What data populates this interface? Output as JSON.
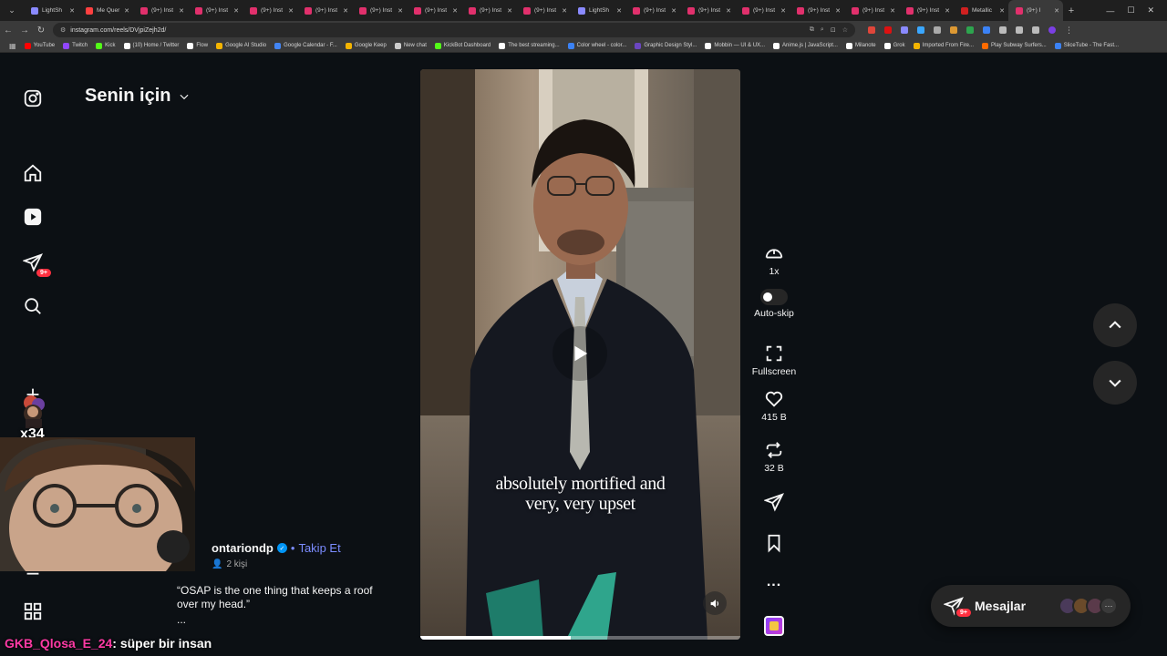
{
  "browser": {
    "tabs": [
      {
        "label": "LightSh",
        "color": "#8a8aff"
      },
      {
        "label": "Me Quer",
        "color": "#ff4040"
      },
      {
        "label": "(9+) Inst",
        "color": "#e1306c"
      },
      {
        "label": "(9+) Inst",
        "color": "#e1306c"
      },
      {
        "label": "(9+) Inst",
        "color": "#e1306c"
      },
      {
        "label": "(9+) Inst",
        "color": "#e1306c"
      },
      {
        "label": "(9+) Inst",
        "color": "#e1306c"
      },
      {
        "label": "(9+) Inst",
        "color": "#e1306c"
      },
      {
        "label": "(9+) Inst",
        "color": "#e1306c"
      },
      {
        "label": "(9+) Inst",
        "color": "#e1306c"
      },
      {
        "label": "LightSh",
        "color": "#8a8aff"
      },
      {
        "label": "(9+) Inst",
        "color": "#e1306c"
      },
      {
        "label": "(9+) Inst",
        "color": "#e1306c"
      },
      {
        "label": "(9+) Inst",
        "color": "#e1306c"
      },
      {
        "label": "(9+) Inst",
        "color": "#e1306c"
      },
      {
        "label": "(9+) Inst",
        "color": "#e1306c"
      },
      {
        "label": "(9+) Inst",
        "color": "#e1306c"
      },
      {
        "label": "Metallic",
        "color": "#d02020"
      },
      {
        "label": "(9+) I",
        "color": "#e1306c"
      }
    ],
    "new_tab": "+",
    "url": "instagram.com/reels/DVjpiZejh2d/",
    "bookmarks": [
      {
        "label": "YouTube",
        "color": "#ff0000"
      },
      {
        "label": "Twitch",
        "color": "#9146ff"
      },
      {
        "label": "Kick",
        "color": "#53fc18"
      },
      {
        "label": "(10) Home / Twitter",
        "color": "#ffffff"
      },
      {
        "label": "Flow",
        "color": "#ffffff"
      },
      {
        "label": "Google AI Studio",
        "color": "#f4b400"
      },
      {
        "label": "Google Calendar - F...",
        "color": "#4285f4"
      },
      {
        "label": "Google Keep",
        "color": "#f4b400"
      },
      {
        "label": "New chat",
        "color": "#cccccc"
      },
      {
        "label": "KickBot Dashboard",
        "color": "#53fc18"
      },
      {
        "label": "The best streaming...",
        "color": "#ffffff"
      },
      {
        "label": "Color wheel - color...",
        "color": "#3b82f6"
      },
      {
        "label": "Graphic Design Styl...",
        "color": "#6b46c1"
      },
      {
        "label": "Mobbin — UI & UX...",
        "color": "#ffffff"
      },
      {
        "label": "Anime.js | JavaScript...",
        "color": "#ffffff"
      },
      {
        "label": "Milanote",
        "color": "#ffffff"
      },
      {
        "label": "Grok",
        "color": "#ffffff"
      },
      {
        "label": "Imported From Fire...",
        "color": "#f4b400"
      },
      {
        "label": "Play Subway Surfers...",
        "color": "#ff6b00"
      },
      {
        "label": "SliceTube - The Fast...",
        "color": "#3b82f6"
      }
    ]
  },
  "feed": {
    "title": "Senin için"
  },
  "nav": {
    "notifications_badge": "9+"
  },
  "reel": {
    "caption_line1": "absolutely mortified and",
    "caption_line2": "very, very upset",
    "progress": 0.47,
    "author": "ontariondp",
    "separator": "•",
    "follow_label": "Takip Et",
    "collab_count": "2 kişi",
    "description": "“OSAP is the one thing that keeps a roof over my head.”",
    "more": "..."
  },
  "actions": {
    "speed": "1x",
    "autoskip": "Auto-skip",
    "fullscreen": "Fullscreen",
    "likes": "415 B",
    "reposts": "32 B",
    "more_glyph": "..."
  },
  "messages": {
    "label": "Mesajlar",
    "badge": "9+",
    "more_glyph": "···"
  },
  "overlay": {
    "story_count": "x34",
    "chat_user": "GKB_Qlosa_E_24",
    "chat_message": ": süper bir insan"
  }
}
